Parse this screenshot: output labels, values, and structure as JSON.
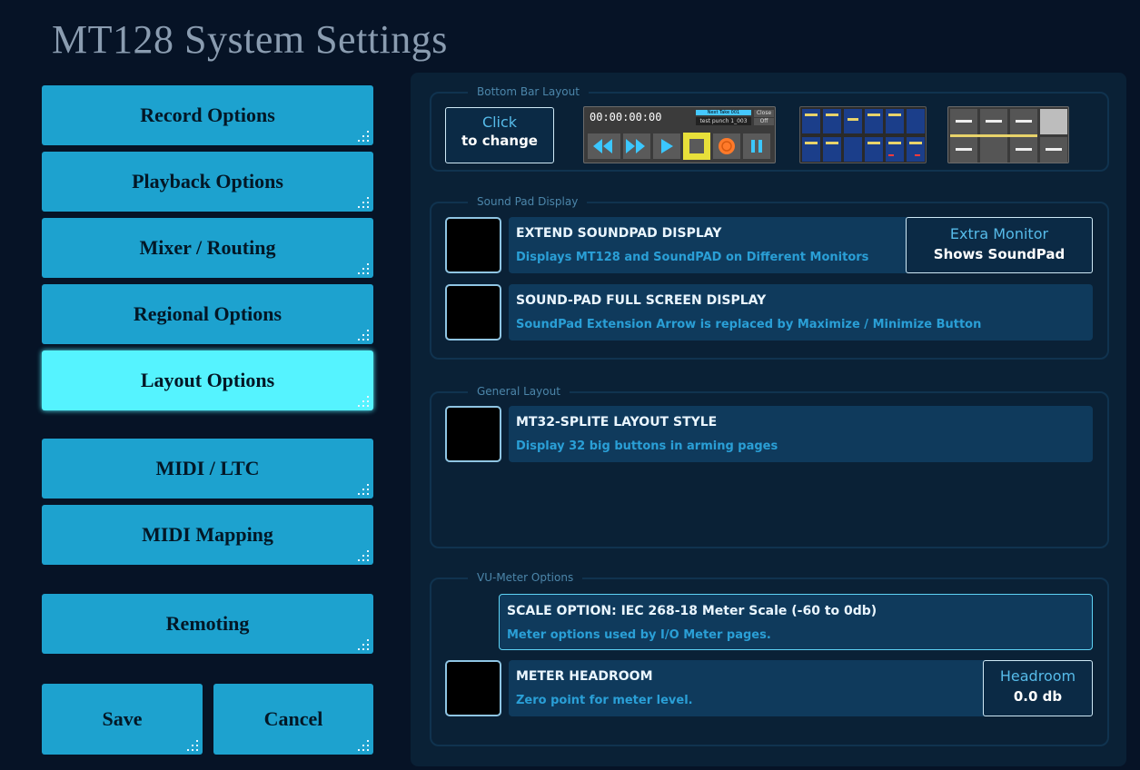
{
  "title": "MT128 System Settings",
  "nav": {
    "record": "Record Options",
    "playback": "Playback Options",
    "mixer": "Mixer / Routing",
    "regional": "Regional Options",
    "layout": "Layout Options",
    "midi_ltc": "MIDI / LTC",
    "midi_mapping": "MIDI Mapping",
    "remoting": "Remoting",
    "save": "Save",
    "cancel": "Cancel"
  },
  "sections": {
    "bottom_bar": {
      "legend": "Bottom Bar Layout",
      "click_line1": "Click",
      "click_line2": "to change",
      "transport_time": "00:00:00:00",
      "transport_take": "Next Take 001",
      "transport_punch": "test punch 1_003",
      "transport_close": "Close",
      "transport_off": "Off"
    },
    "sound_pad": {
      "legend": "Sound Pad Display",
      "extend_title": "EXTEND SOUNDPAD DISPLAY",
      "extend_desc": "Displays MT128 and SoundPAD on Different Monitors",
      "extra_label": "Extra Monitor",
      "extra_value": "Shows SoundPad",
      "fullscreen_title": "SOUND-PAD FULL SCREEN DISPLAY",
      "fullscreen_desc": "SoundPad Extension Arrow is replaced by Maximize / Minimize Button"
    },
    "general": {
      "legend": "General Layout",
      "mt32_title": "MT32-SPLITE LAYOUT STYLE",
      "mt32_desc": "Display 32 big buttons in arming pages"
    },
    "vu": {
      "legend": "VU-Meter Options",
      "scale_title": "SCALE OPTION: IEC 268-18 Meter Scale (-60 to 0db)",
      "scale_desc": "Meter options used by I/O Meter pages.",
      "headroom_title": "METER HEADROOM",
      "headroom_desc": "Zero point for meter level.",
      "headroom_label": "Headroom",
      "headroom_value": "0.0 db"
    }
  },
  "colors": {
    "background": "#061326",
    "nav_button": "#1da2cf",
    "nav_active": "#55f3ff",
    "panel": "#0a2136",
    "option_row": "#0f3a5c"
  }
}
